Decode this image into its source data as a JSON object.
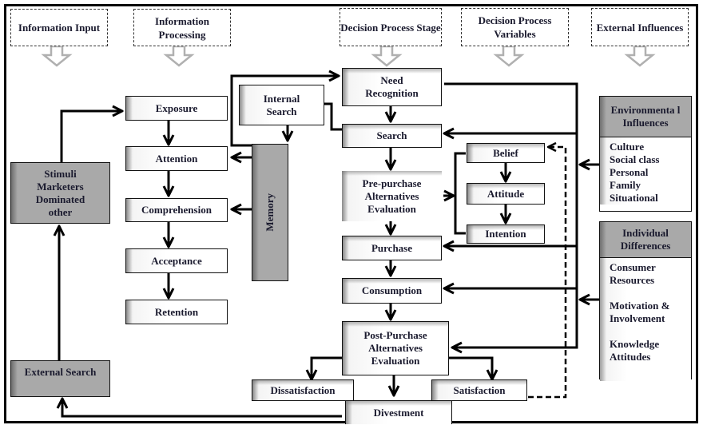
{
  "headers": [
    {
      "id": "information-input",
      "label": "Information Input"
    },
    {
      "id": "information-processing",
      "label": "Information Processing"
    },
    {
      "id": "decision-process-stage",
      "label": "Decision Process Stage"
    },
    {
      "id": "decision-process-variables",
      "label": "Decision Process Variables"
    },
    {
      "id": "external-influences",
      "label": "External Influences"
    }
  ],
  "input": {
    "stimuli": "Stimuli Marketers Dominated other",
    "external_search": "External Search"
  },
  "processing": {
    "exposure": "Exposure",
    "attention": "Attention",
    "comprehension": "Comprehension",
    "acceptance": "Acceptance",
    "retention": "Retention",
    "internal_search": "Internal Search",
    "memory": "Memory"
  },
  "decision": {
    "need_recognition": "Need Recognition",
    "search": "Search",
    "pre_purchase": "Pre-purchase Alternatives Evaluation",
    "purchase": "Purchase",
    "consumption": "Consumption",
    "post_purchase": "Post-Purchase Alternatives Evaluation",
    "dissatisfaction": "Dissatisfaction",
    "satisfaction": "Satisfaction",
    "divestment": "Divestment"
  },
  "variables": {
    "belief": "Belief",
    "attitude": "Attitude",
    "intention": "Intention"
  },
  "environmental": {
    "title": "Environmenta l Influences",
    "items": [
      "Culture",
      "Social class",
      "Personal",
      "Family",
      "Situational"
    ]
  },
  "individual": {
    "title": "Individual Differences",
    "items": [
      "Consumer",
      "Resources",
      "",
      "Motivation &",
      "Involvement",
      "",
      "Knowledge",
      "Attitudes"
    ]
  },
  "colors": {
    "gray_box": "#a9a9a9",
    "header_arrow": "#b0b0b0",
    "text": "#1a1a2e"
  }
}
